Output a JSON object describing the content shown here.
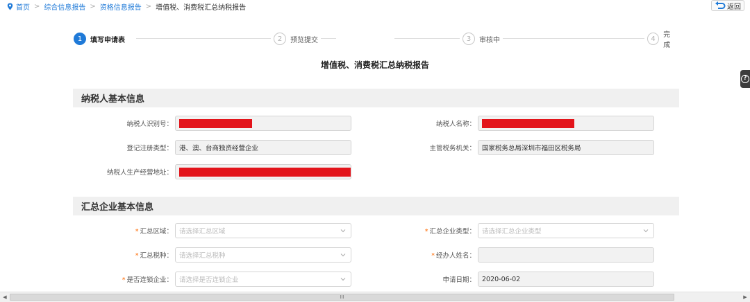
{
  "breadcrumb": {
    "home": "首页",
    "level1": "综合信息报告",
    "level2": "资格信息报告",
    "current": "增值税、消费税汇总纳税报告",
    "separator": ">"
  },
  "back_button": "返回",
  "help_icon": "?",
  "steps": [
    {
      "num": "1",
      "label": "填写申请表",
      "active": true
    },
    {
      "num": "2",
      "label": "预览提交",
      "active": false
    },
    {
      "num": "3",
      "label": "审核中",
      "active": false
    },
    {
      "num": "4",
      "label": "完成",
      "active": false
    }
  ],
  "form_title": "增值税、消费税汇总纳税报告",
  "section_basic": {
    "title": "纳税人基本信息",
    "taxpayer_id_label": "纳税人识别号：",
    "taxpayer_name_label": "纳税人名称：",
    "reg_type_label": "登记注册类型：",
    "reg_type_value": "港、澳、台商独资经营企业",
    "tax_authority_label": "主管税务机关：",
    "tax_authority_value": "国家税务总局深圳市福田区税务局",
    "address_label": "纳税人生产经营地址："
  },
  "section_summary": {
    "title": "汇总企业基本信息",
    "region_label": "汇总区域：",
    "region_placeholder": "请选择汇总区域",
    "company_type_label": "汇总企业类型：",
    "company_type_placeholder": "请选择汇总企业类型",
    "tax_type_label": "汇总税种：",
    "tax_type_placeholder": "请选择汇总税种",
    "handler_label": "经办人姓名：",
    "handler_value": "",
    "chain_label": "是否连锁企业：",
    "chain_placeholder": "请选择是否连锁企业",
    "apply_date_label": "申请日期：",
    "apply_date_value": "2020-06-02",
    "required_mark": "*"
  },
  "scrollbar": {
    "grip": "III",
    "left_arrow": "◀",
    "right_arrow": "▶"
  },
  "colors": {
    "accent": "#1f7ad8",
    "required": "#ff6a00",
    "redaction": "#e3141b"
  }
}
